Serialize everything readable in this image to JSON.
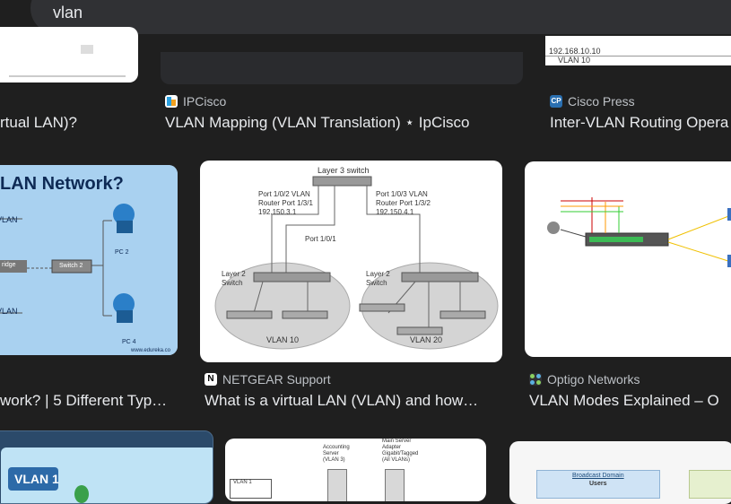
{
  "search": {
    "query": "vlan"
  },
  "row1": {
    "card1": {
      "title": "rtual LAN)?"
    },
    "card2": {
      "source": "IPCisco",
      "title": "VLAN Mapping (VLAN Translation) ⋆ IpCisco"
    },
    "card3": {
      "source": "Cisco Press",
      "title": "Inter-VLAN Routing Opera",
      "thumb_lines": [
        "192.168.10.10",
        "VLAN 10"
      ]
    }
  },
  "row2": {
    "card1": {
      "title": "work? | 5 Different Typ…",
      "thumb": {
        "heading": "LAN Network?",
        "labels": [
          "VLAN",
          "VLAN",
          "ridge",
          "Switch 2",
          "PC 2",
          "PC 4",
          "www.edureka.co"
        ]
      }
    },
    "card2": {
      "source": "NETGEAR Support",
      "title": "What is a virtual LAN (VLAN) and how…",
      "thumb": {
        "l3": "Layer 3 switch",
        "left_port": [
          "Port 1/0/2 VLAN",
          "Router Port 1/3/1",
          "192.150.3.1"
        ],
        "right_port": [
          "Port 1/0/3 VLAN",
          "Router Port 1/3/2",
          "192.150.4.1"
        ],
        "port101": "Port 1/0/1",
        "l2a": [
          "Layer 2",
          "Switch"
        ],
        "l2b": [
          "Layer 2",
          "Switch"
        ],
        "vlan10": "VLAN 10",
        "vlan20": "VLAN 20"
      }
    },
    "card3": {
      "source": "Optigo Networks",
      "title": "VLAN Modes Explained – O"
    }
  },
  "row3": {
    "card1": {
      "label": "VLAN 1"
    },
    "card2": {
      "labels": [
        "Accounting",
        "Server",
        "(VLAN 3)",
        "Main Server",
        "Adapter",
        "Gigabit/Tagged",
        "(All VLANs)",
        "VLAN 1"
      ]
    },
    "card3": {
      "labels": [
        "Broadcast Domain",
        "Users"
      ]
    }
  },
  "colors": {
    "bg": "#1f1f1f",
    "search": "#303134",
    "text": "#e8eaed",
    "muted": "#bdc1c6"
  }
}
